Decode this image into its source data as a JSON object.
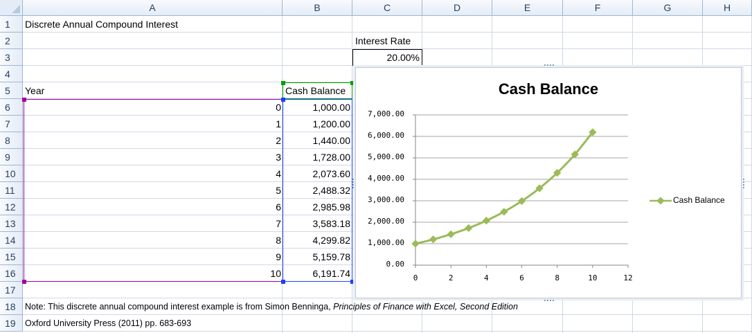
{
  "columns": [
    "A",
    "B",
    "C",
    "D",
    "E",
    "F",
    "G",
    "H"
  ],
  "rows": [
    "1",
    "2",
    "3",
    "4",
    "5",
    "6",
    "7",
    "8",
    "9",
    "10",
    "11",
    "12",
    "13",
    "14",
    "15",
    "16",
    "17",
    "18",
    "19"
  ],
  "sheet": {
    "title": "Discrete Annual Compound Interest",
    "rate_label": "Interest Rate",
    "rate_value": "20.00%",
    "year_header": "Year",
    "balance_header": "Cash Balance",
    "years": [
      "0",
      "1",
      "2",
      "3",
      "4",
      "5",
      "6",
      "7",
      "8",
      "9",
      "10"
    ],
    "balances": [
      "1,000.00",
      "1,200.00",
      "1,440.00",
      "1,728.00",
      "2,073.60",
      "2,488.32",
      "2,985.98",
      "3,583.18",
      "4,299.82",
      "5,159.78",
      "6,191.74"
    ],
    "note_prefix": "Note: This discrete annual compound interest example is from Simon Benninga, ",
    "note_book": "Principles of Finance with Excel, Second Edition",
    "note_line2": "Oxford University Press (2011) pp. 683-693"
  },
  "colors": {
    "series": "#9bbb59",
    "gridline": "#868686",
    "selection_green": "#00a000",
    "selection_blue": "#1f3fff",
    "selection_purple": "#a000a0"
  },
  "chart_data": {
    "type": "scatter",
    "title": "Cash Balance",
    "xlabel": "",
    "ylabel": "",
    "x": [
      0,
      1,
      2,
      3,
      4,
      5,
      6,
      7,
      8,
      9,
      10
    ],
    "series": [
      {
        "name": "Cash Balance",
        "values": [
          1000.0,
          1200.0,
          1440.0,
          1728.0,
          2073.6,
          2488.32,
          2985.98,
          3583.18,
          4299.82,
          5159.78,
          6191.74
        ]
      }
    ],
    "xlim": [
      0,
      12
    ],
    "ylim": [
      0,
      7000
    ],
    "xticks": [
      "0",
      "2",
      "4",
      "6",
      "8",
      "10",
      "12"
    ],
    "yticks": [
      "0.00",
      "1,000.00",
      "2,000.00",
      "3,000.00",
      "4,000.00",
      "5,000.00",
      "6,000.00",
      "7,000.00"
    ],
    "grid": "horizontal",
    "legend": "right",
    "marker": "diamond",
    "line": "smooth"
  }
}
